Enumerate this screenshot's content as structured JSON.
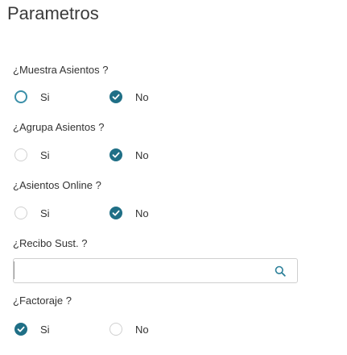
{
  "page": {
    "title": "Parametros"
  },
  "groups": [
    {
      "label": "¿Muestra Asientos ?",
      "options": [
        {
          "label": "Si",
          "state": "unchecked-active"
        },
        {
          "label": "No",
          "state": "checked"
        }
      ]
    },
    {
      "label": "¿Agrupa Asientos ?",
      "options": [
        {
          "label": "Si",
          "state": "unchecked"
        },
        {
          "label": "No",
          "state": "checked"
        }
      ]
    },
    {
      "label": "¿Asientos Online ?",
      "options": [
        {
          "label": "Si",
          "state": "unchecked"
        },
        {
          "label": "No",
          "state": "checked"
        }
      ]
    }
  ],
  "recibo": {
    "label": "¿Recibo Sust. ?",
    "value": "",
    "placeholder": "",
    "icon": "search-icon"
  },
  "factoraje": {
    "label": "¿Factoraje ?",
    "options": [
      {
        "label": "Si",
        "state": "checked"
      },
      {
        "label": "No",
        "state": "unchecked"
      }
    ]
  },
  "colors": {
    "accent": "#1f6f86",
    "active_border": "#3a8fa8",
    "inactive_border": "#d0d0d0",
    "text": "#333333"
  }
}
